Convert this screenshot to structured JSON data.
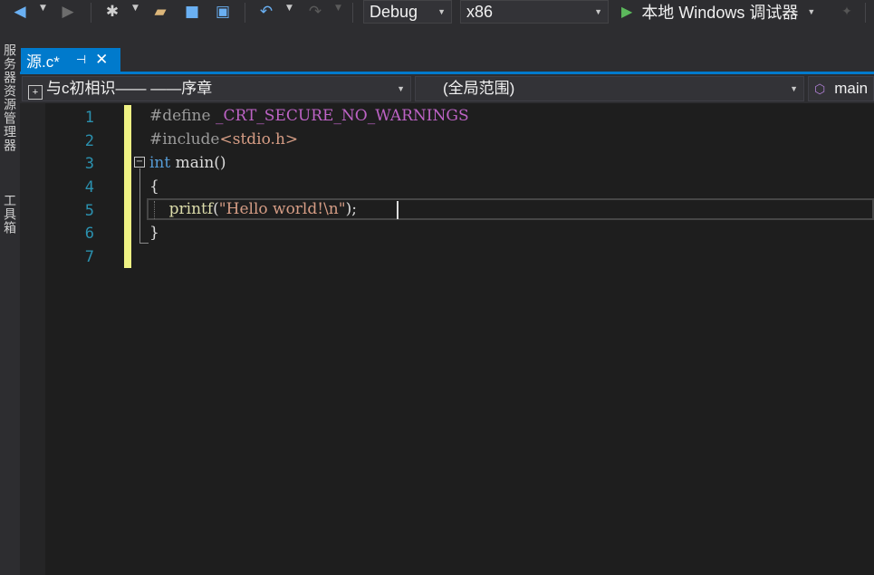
{
  "toolbar": {
    "config": "Debug",
    "platform": "x86",
    "run_label": "本地 Windows 调试器"
  },
  "side_tabs": {
    "server_explorer": "服务器资源管理器",
    "toolbox": "工具箱"
  },
  "document_tab": {
    "title": "源.c*",
    "pin": "⊣",
    "close": "✕"
  },
  "navigation": {
    "project": "与c初相识—— ——序章",
    "scope": "(全局范围)",
    "member": "main"
  },
  "editor": {
    "line_numbers": [
      "1",
      "2",
      "3",
      "4",
      "5",
      "6",
      "7"
    ],
    "lines": {
      "l1_directive": "#define",
      "l1_macro": "_CRT_SECURE_NO_WARNINGS",
      "l2_directive": "#include",
      "l2_header": "<stdio.h>",
      "l3_type": "int",
      "l3_rest": " main()",
      "l4": "{",
      "l5_indent": "    ",
      "l5_fn": "printf",
      "l5_open": "(",
      "l5_string": "\"Hello world!\\n\"",
      "l5_close": ");",
      "l6": "}"
    }
  },
  "colors": {
    "accent": "#007acc",
    "keyword": "#569cd6",
    "string": "#d69d85",
    "function": "#dcdcaa",
    "macro": "#bd63c5",
    "line_number": "#2b91af",
    "change_bar": "#eff284"
  }
}
